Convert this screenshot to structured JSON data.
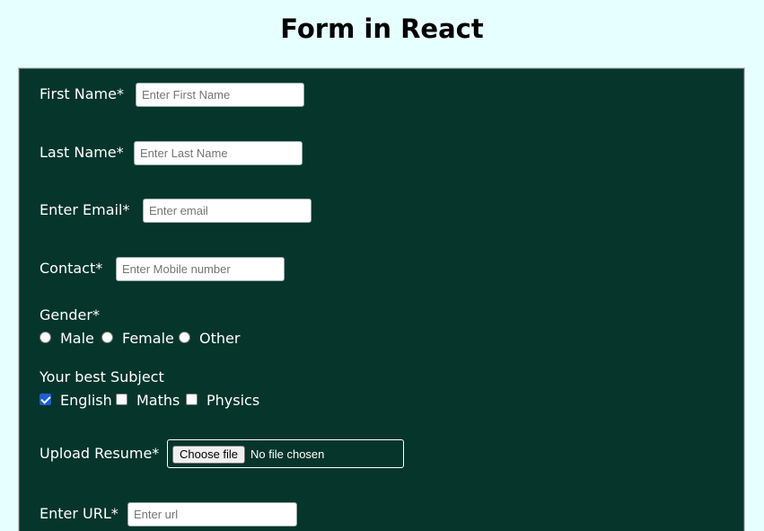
{
  "page": {
    "title": "Form in React"
  },
  "form": {
    "first_name": {
      "label": "First Name*",
      "placeholder": "Enter First Name",
      "value": ""
    },
    "last_name": {
      "label": "Last Name*",
      "placeholder": "Enter Last Name",
      "value": ""
    },
    "email": {
      "label": "Enter Email*",
      "placeholder": "Enter email",
      "value": ""
    },
    "contact": {
      "label": "Contact*",
      "placeholder": "Enter Mobile number",
      "value": ""
    },
    "gender": {
      "label": "Gender*",
      "options": [
        {
          "label": "Male",
          "selected": false
        },
        {
          "label": "Female",
          "selected": false
        },
        {
          "label": "Other",
          "selected": false
        }
      ]
    },
    "subjects": {
      "label": "Your best Subject",
      "options": [
        {
          "label": "English",
          "checked": true
        },
        {
          "label": "Maths",
          "checked": false
        },
        {
          "label": "Physics",
          "checked": false
        }
      ]
    },
    "resume": {
      "label": "Upload Resume*",
      "button": "Choose file",
      "status": "No file chosen"
    },
    "url": {
      "label": "Enter URL*",
      "placeholder": "Enter url",
      "value": ""
    }
  },
  "colors": {
    "background": "#e6ffff",
    "panel": "#05352b",
    "checkbox_accent": "#1a5fd6"
  }
}
